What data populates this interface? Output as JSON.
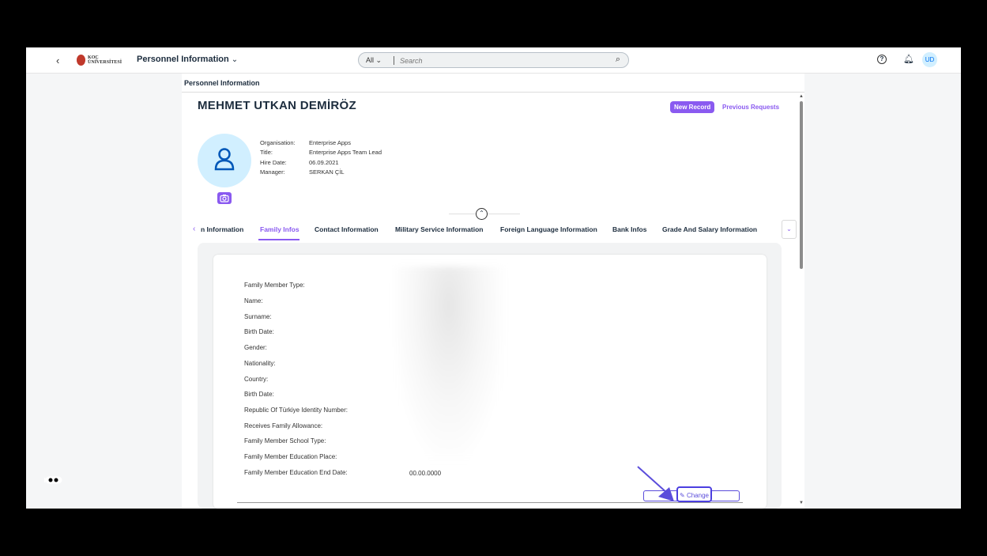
{
  "shell": {
    "back_label": "‹",
    "logo_text": "KOÇ ÜNİVERSİTESİ",
    "app_title": "Personnel Information",
    "search_scope": "All",
    "search_placeholder": "Search",
    "user_initials": "UD"
  },
  "page": {
    "title": "Personnel Information",
    "person_name": "MEHMET UTKAN DEMİRÖZ",
    "new_record_label": "New Record",
    "previous_requests_label": "Previous Requests",
    "attributes": [
      {
        "label": "Organisation:",
        "value": "Enterprise Apps"
      },
      {
        "label": "Title:",
        "value": "Enterprise Apps Team Lead"
      },
      {
        "label": "Hire Date:",
        "value": "06.09.2021"
      },
      {
        "label": "Manager:",
        "value": "SERKAN ÇİL"
      }
    ]
  },
  "tabs": [
    {
      "label": "n Information"
    },
    {
      "label": "Family Infos",
      "active": true
    },
    {
      "label": "Contact Information"
    },
    {
      "label": "Military Service Information"
    },
    {
      "label": "Foreign Language Information"
    },
    {
      "label": "Bank Infos"
    },
    {
      "label": "Grade And Salary Information"
    }
  ],
  "family_fields": [
    "Family Member Type:",
    "Name:",
    "Surname:",
    "Birth Date:",
    "Gender:",
    "Nationality:",
    "Country:",
    "Birth Date:",
    "Republic Of Türkiye Identity Number:",
    "Receives Family Allowance:",
    "Family Member School Type:",
    "Family Member Education Place:",
    "Family Member Education End Date:"
  ],
  "education_end_date_value": "00.00.0000",
  "change_label": "Change",
  "colors": {
    "accent": "#8a5af0",
    "annotation": "#5b4ddb"
  }
}
